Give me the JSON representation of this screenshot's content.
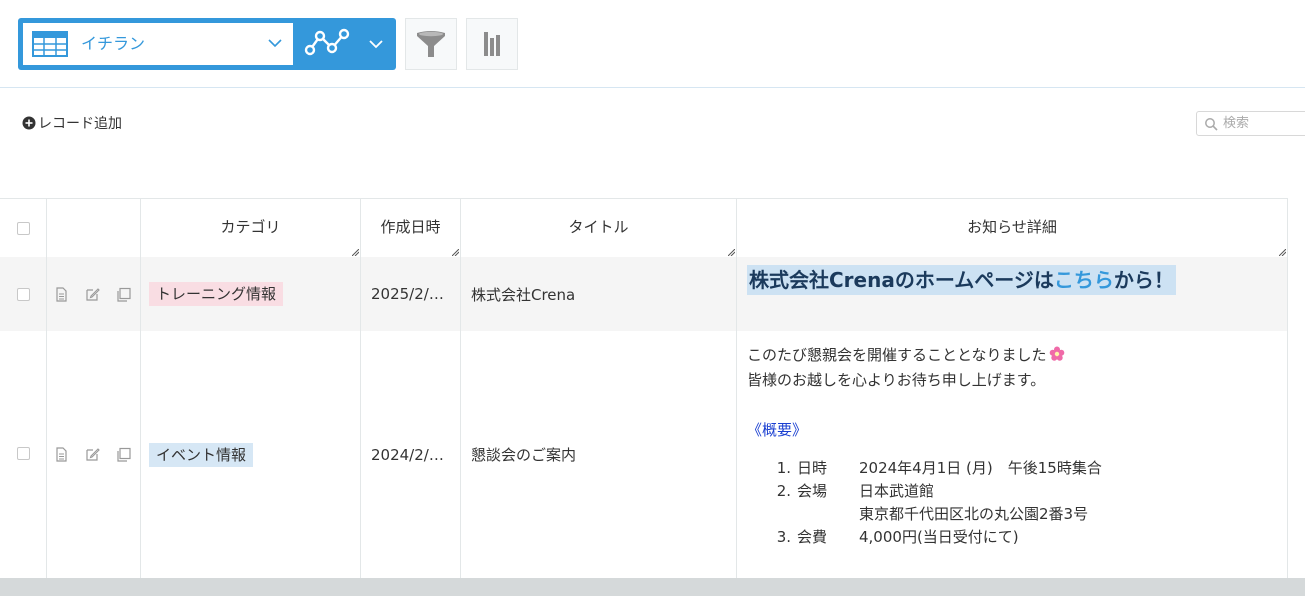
{
  "toolbar": {
    "view_label": "イチラン",
    "accent_color": "#3498db",
    "icons": [
      "table-icon",
      "chevron-down-icon",
      "graph-icon",
      "chevron-down-icon",
      "filter-icon",
      "chart-bar-icon"
    ]
  },
  "actions": {
    "add_record": "レコード追加",
    "search_placeholder": "検索"
  },
  "table": {
    "columns": [
      "カテゴリ",
      "作成日時",
      "タイトル",
      "お知らせ詳細"
    ],
    "rows": [
      {
        "category": "トレーニング情報",
        "created": "2025/2/…",
        "title": "株式会社Crena",
        "detail_prefix": "株式会社Crenaのホームページは",
        "detail_link": "こちら",
        "detail_suffix": "から！"
      },
      {
        "category": "イベント情報",
        "created": "2024/2/…",
        "title": "懇談会のご案内",
        "detail_line1": "このたび懇親会を開催することとなりました",
        "detail_line2": "皆様のお越しを心よりお待ち申し上げます。",
        "overview_heading": "《概要》",
        "items": [
          {
            "num": "1.",
            "label": "日時",
            "value": "2024年4月1日 (月)　午後15時集合"
          },
          {
            "num": "2.",
            "label": "会場",
            "value": "日本武道館"
          },
          {
            "num": "",
            "label": "",
            "value": "東京都千代田区北の丸公園2番3号"
          },
          {
            "num": "3.",
            "label": "会費",
            "value": "4,000円(当日受付にて)"
          }
        ]
      }
    ]
  }
}
